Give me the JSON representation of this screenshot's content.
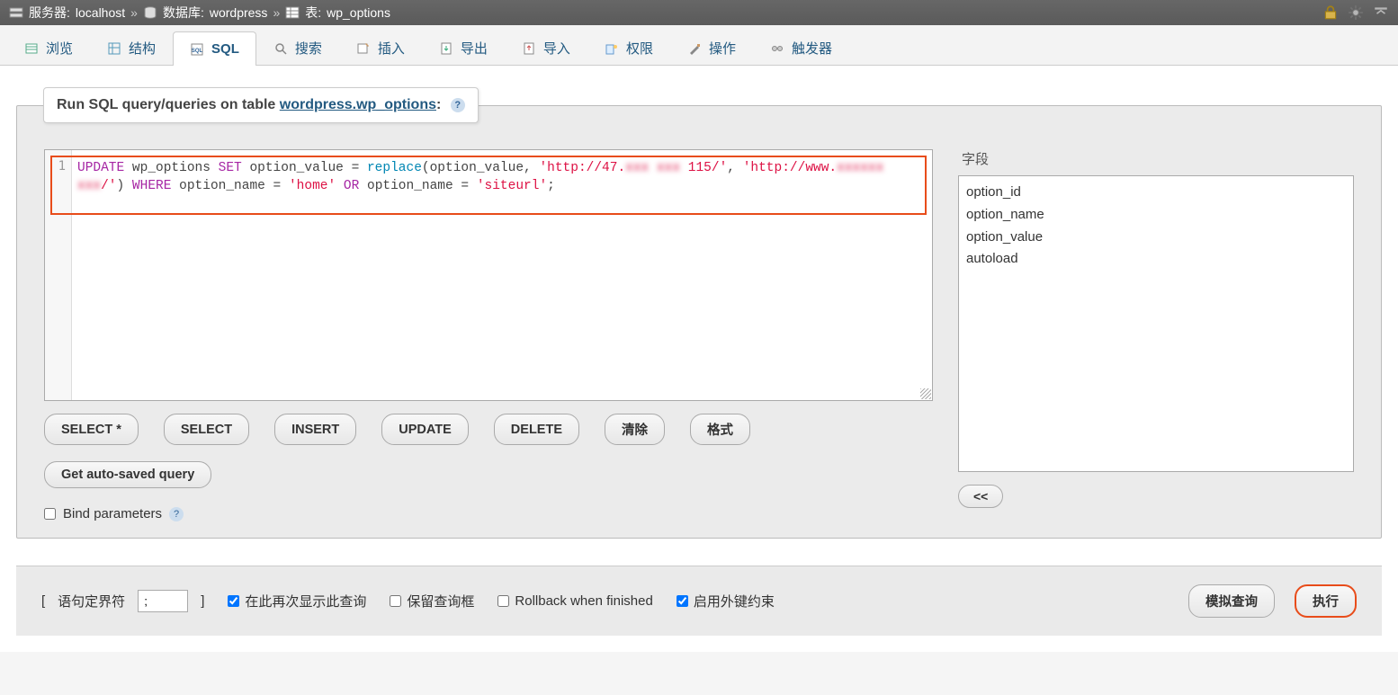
{
  "breadcrumb": {
    "server_label": "服务器:",
    "server_value": "localhost",
    "db_label": "数据库:",
    "db_value": "wordpress",
    "table_label": "表:",
    "table_value": "wp_options"
  },
  "tabs": [
    {
      "label": "浏览",
      "icon": "browse"
    },
    {
      "label": "结构",
      "icon": "structure"
    },
    {
      "label": "SQL",
      "icon": "sql",
      "active": true
    },
    {
      "label": "搜索",
      "icon": "search"
    },
    {
      "label": "插入",
      "icon": "insert"
    },
    {
      "label": "导出",
      "icon": "export"
    },
    {
      "label": "导入",
      "icon": "import"
    },
    {
      "label": "权限",
      "icon": "privileges"
    },
    {
      "label": "操作",
      "icon": "operations"
    },
    {
      "label": "触发器",
      "icon": "triggers"
    }
  ],
  "panel": {
    "title_prefix": "Run SQL query/queries on table ",
    "title_link": "wordpress.wp_options",
    "title_suffix": ":"
  },
  "sql": {
    "line_number": "1",
    "tokens": [
      {
        "cls": "kw",
        "t": "UPDATE"
      },
      {
        "cls": "",
        "t": " wp_options "
      },
      {
        "cls": "kw",
        "t": "SET"
      },
      {
        "cls": "",
        "t": " option_value = "
      },
      {
        "cls": "fn",
        "t": "replace"
      },
      {
        "cls": "",
        "t": "(option_value, "
      },
      {
        "cls": "str",
        "t": "'http://47."
      },
      {
        "cls": "blur",
        "t": "xxx xxx "
      },
      {
        "cls": "str",
        "t": "115/'"
      },
      {
        "cls": "",
        "t": ", "
      },
      {
        "cls": "str",
        "t": "'http://www."
      },
      {
        "cls": "blur",
        "t": "xxxxxx xxx"
      },
      {
        "cls": "str",
        "t": "/'"
      },
      {
        "cls": "",
        "t": ") "
      },
      {
        "cls": "kw",
        "t": "WHERE"
      },
      {
        "cls": "",
        "t": " option_name = "
      },
      {
        "cls": "str",
        "t": "'home'"
      },
      {
        "cls": "",
        "t": " "
      },
      {
        "cls": "kw",
        "t": "OR"
      },
      {
        "cls": "",
        "t": " option_name = "
      },
      {
        "cls": "str",
        "t": "'siteurl'"
      },
      {
        "cls": "",
        "t": ";"
      }
    ]
  },
  "fields": {
    "label": "字段",
    "items": [
      "option_id",
      "option_name",
      "option_value",
      "autoload"
    ]
  },
  "buttons": {
    "select_star": "SELECT *",
    "select": "SELECT",
    "insert": "INSERT",
    "update": "UPDATE",
    "delete": "DELETE",
    "clear": "清除",
    "format": "格式",
    "get_auto": "Get auto-saved query",
    "insert_field": "<<"
  },
  "bind": {
    "label": "Bind parameters"
  },
  "footer": {
    "delim_open": "[ ",
    "delim_label": "语句定界符",
    "delim_value": ";",
    "delim_close": " ]",
    "show_again": "在此再次显示此查询",
    "keep_box": "保留查询框",
    "rollback": "Rollback when finished",
    "fk": "启用外键约束",
    "simulate": "模拟查询",
    "go": "执行"
  }
}
